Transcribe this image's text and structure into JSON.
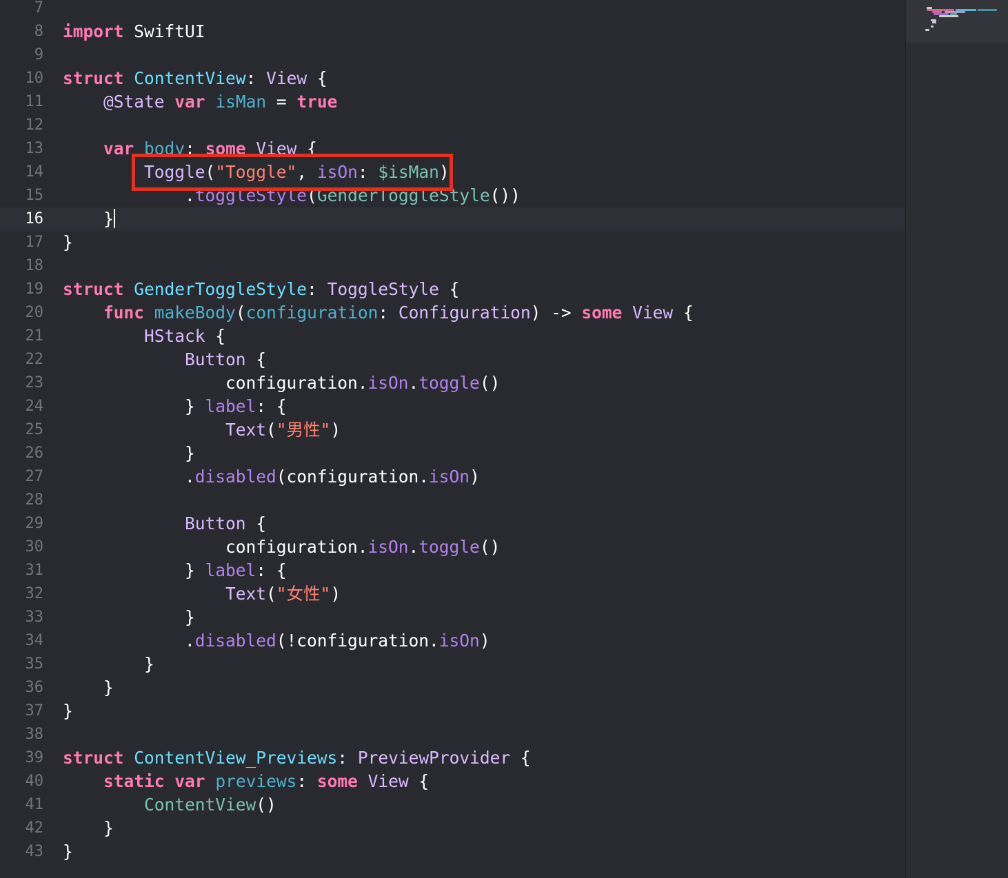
{
  "editor": {
    "language": "Swift",
    "current_line": "16",
    "lines": [
      {
        "n": "7",
        "tokens": []
      },
      {
        "n": "8",
        "tokens": [
          {
            "t": "import",
            "c": "kw"
          },
          {
            "t": " SwiftUI",
            "c": "pl"
          }
        ]
      },
      {
        "n": "9",
        "tokens": []
      },
      {
        "n": "10",
        "tokens": [
          {
            "t": "struct",
            "c": "kw"
          },
          {
            "t": " ",
            "c": "pl"
          },
          {
            "t": "ContentView",
            "c": "decl"
          },
          {
            "t": ": ",
            "c": "pl"
          },
          {
            "t": "View",
            "c": "typ"
          },
          {
            "t": " {",
            "c": "pl"
          }
        ]
      },
      {
        "n": "11",
        "tokens": [
          {
            "t": "    ",
            "c": "pl"
          },
          {
            "t": "@State",
            "c": "typ"
          },
          {
            "t": " ",
            "c": "pl"
          },
          {
            "t": "var",
            "c": "kw"
          },
          {
            "t": " ",
            "c": "pl"
          },
          {
            "t": "isMan",
            "c": "vdecl"
          },
          {
            "t": " = ",
            "c": "pl"
          },
          {
            "t": "true",
            "c": "kw"
          }
        ]
      },
      {
        "n": "12",
        "tokens": []
      },
      {
        "n": "13",
        "tokens": [
          {
            "t": "    ",
            "c": "pl"
          },
          {
            "t": "var",
            "c": "kw"
          },
          {
            "t": " ",
            "c": "pl"
          },
          {
            "t": "body",
            "c": "vdecl"
          },
          {
            "t": ": ",
            "c": "pl"
          },
          {
            "t": "some",
            "c": "kw"
          },
          {
            "t": " ",
            "c": "pl"
          },
          {
            "t": "View",
            "c": "typ"
          },
          {
            "t": " {",
            "c": "pl"
          }
        ]
      },
      {
        "n": "14",
        "tokens": []
      },
      {
        "n": "15",
        "tokens": [
          {
            "t": "            ",
            "c": "pl"
          },
          {
            "t": ".",
            "c": "pl"
          },
          {
            "t": "toggleStyle",
            "c": "mem"
          },
          {
            "t": "(",
            "c": "pl"
          },
          {
            "t": "GenderToggleStyle",
            "c": "prop"
          },
          {
            "t": "())",
            "c": "pl"
          }
        ]
      },
      {
        "n": "16",
        "tokens": [
          {
            "t": "    }",
            "c": "pl"
          }
        ],
        "cursor": true
      },
      {
        "n": "17",
        "tokens": [
          {
            "t": "}",
            "c": "pl"
          }
        ]
      },
      {
        "n": "18",
        "tokens": []
      },
      {
        "n": "19",
        "tokens": [
          {
            "t": "struct",
            "c": "kw"
          },
          {
            "t": " ",
            "c": "pl"
          },
          {
            "t": "GenderToggleStyle",
            "c": "decl"
          },
          {
            "t": ": ",
            "c": "pl"
          },
          {
            "t": "ToggleStyle",
            "c": "typ"
          },
          {
            "t": " {",
            "c": "pl"
          }
        ]
      },
      {
        "n": "20",
        "tokens": [
          {
            "t": "    ",
            "c": "pl"
          },
          {
            "t": "func",
            "c": "kw"
          },
          {
            "t": " ",
            "c": "pl"
          },
          {
            "t": "makeBody",
            "c": "vdecl"
          },
          {
            "t": "(",
            "c": "pl"
          },
          {
            "t": "configuration",
            "c": "vdecl"
          },
          {
            "t": ": ",
            "c": "pl"
          },
          {
            "t": "Configuration",
            "c": "typ"
          },
          {
            "t": ") -> ",
            "c": "pl"
          },
          {
            "t": "some",
            "c": "kw"
          },
          {
            "t": " ",
            "c": "pl"
          },
          {
            "t": "View",
            "c": "typ"
          },
          {
            "t": " {",
            "c": "pl"
          }
        ]
      },
      {
        "n": "21",
        "tokens": [
          {
            "t": "        ",
            "c": "pl"
          },
          {
            "t": "HStack",
            "c": "typ"
          },
          {
            "t": " {",
            "c": "pl"
          }
        ]
      },
      {
        "n": "22",
        "tokens": [
          {
            "t": "            ",
            "c": "pl"
          },
          {
            "t": "Button",
            "c": "typ"
          },
          {
            "t": " {",
            "c": "pl"
          }
        ]
      },
      {
        "n": "23",
        "tokens": [
          {
            "t": "                configuration.",
            "c": "pl"
          },
          {
            "t": "isOn",
            "c": "mem"
          },
          {
            "t": ".",
            "c": "pl"
          },
          {
            "t": "toggle",
            "c": "mem"
          },
          {
            "t": "()",
            "c": "pl"
          }
        ]
      },
      {
        "n": "24",
        "tokens": [
          {
            "t": "            } ",
            "c": "pl"
          },
          {
            "t": "label",
            "c": "mem"
          },
          {
            "t": ": {",
            "c": "pl"
          }
        ]
      },
      {
        "n": "25",
        "tokens": [
          {
            "t": "                ",
            "c": "pl"
          },
          {
            "t": "Text",
            "c": "typ"
          },
          {
            "t": "(",
            "c": "pl"
          },
          {
            "t": "\"男性\"",
            "c": "str"
          },
          {
            "t": ")",
            "c": "pl"
          }
        ]
      },
      {
        "n": "26",
        "tokens": [
          {
            "t": "            }",
            "c": "pl"
          }
        ]
      },
      {
        "n": "27",
        "tokens": [
          {
            "t": "            .",
            "c": "pl"
          },
          {
            "t": "disabled",
            "c": "mem"
          },
          {
            "t": "(configuration.",
            "c": "pl"
          },
          {
            "t": "isOn",
            "c": "mem"
          },
          {
            "t": ")",
            "c": "pl"
          }
        ]
      },
      {
        "n": "28",
        "tokens": []
      },
      {
        "n": "29",
        "tokens": [
          {
            "t": "            ",
            "c": "pl"
          },
          {
            "t": "Button",
            "c": "typ"
          },
          {
            "t": " {",
            "c": "pl"
          }
        ]
      },
      {
        "n": "30",
        "tokens": [
          {
            "t": "                configuration.",
            "c": "pl"
          },
          {
            "t": "isOn",
            "c": "mem"
          },
          {
            "t": ".",
            "c": "pl"
          },
          {
            "t": "toggle",
            "c": "mem"
          },
          {
            "t": "()",
            "c": "pl"
          }
        ]
      },
      {
        "n": "31",
        "tokens": [
          {
            "t": "            } ",
            "c": "pl"
          },
          {
            "t": "label",
            "c": "mem"
          },
          {
            "t": ": {",
            "c": "pl"
          }
        ]
      },
      {
        "n": "32",
        "tokens": [
          {
            "t": "                ",
            "c": "pl"
          },
          {
            "t": "Text",
            "c": "typ"
          },
          {
            "t": "(",
            "c": "pl"
          },
          {
            "t": "\"女性\"",
            "c": "str"
          },
          {
            "t": ")",
            "c": "pl"
          }
        ]
      },
      {
        "n": "33",
        "tokens": [
          {
            "t": "            }",
            "c": "pl"
          }
        ]
      },
      {
        "n": "34",
        "tokens": [
          {
            "t": "            .",
            "c": "pl"
          },
          {
            "t": "disabled",
            "c": "mem"
          },
          {
            "t": "(!configuration.",
            "c": "pl"
          },
          {
            "t": "isOn",
            "c": "mem"
          },
          {
            "t": ")",
            "c": "pl"
          }
        ]
      },
      {
        "n": "35",
        "tokens": [
          {
            "t": "        }",
            "c": "pl"
          }
        ]
      },
      {
        "n": "36",
        "tokens": [
          {
            "t": "    }",
            "c": "pl"
          }
        ]
      },
      {
        "n": "37",
        "tokens": [
          {
            "t": "}",
            "c": "pl"
          }
        ]
      },
      {
        "n": "38",
        "tokens": []
      },
      {
        "n": "39",
        "tokens": [
          {
            "t": "struct",
            "c": "kw"
          },
          {
            "t": " ",
            "c": "pl"
          },
          {
            "t": "ContentView_Previews",
            "c": "decl"
          },
          {
            "t": ": ",
            "c": "pl"
          },
          {
            "t": "PreviewProvider",
            "c": "typ"
          },
          {
            "t": " {",
            "c": "pl"
          }
        ]
      },
      {
        "n": "40",
        "tokens": [
          {
            "t": "    ",
            "c": "pl"
          },
          {
            "t": "static",
            "c": "kw"
          },
          {
            "t": " ",
            "c": "pl"
          },
          {
            "t": "var",
            "c": "kw"
          },
          {
            "t": " ",
            "c": "pl"
          },
          {
            "t": "previews",
            "c": "vdecl"
          },
          {
            "t": ": ",
            "c": "pl"
          },
          {
            "t": "some",
            "c": "kw"
          },
          {
            "t": " ",
            "c": "pl"
          },
          {
            "t": "View",
            "c": "typ"
          },
          {
            "t": " {",
            "c": "pl"
          }
        ]
      },
      {
        "n": "41",
        "tokens": [
          {
            "t": "        ",
            "c": "pl"
          },
          {
            "t": "ContentView",
            "c": "prop"
          },
          {
            "t": "()",
            "c": "pl"
          }
        ]
      },
      {
        "n": "42",
        "tokens": [
          {
            "t": "    }",
            "c": "pl"
          }
        ]
      },
      {
        "n": "43",
        "tokens": [
          {
            "t": "}",
            "c": "pl"
          }
        ]
      }
    ],
    "highlight": {
      "line": "14",
      "tokens": [
        {
          "t": "Toggle",
          "c": "typ"
        },
        {
          "t": "(",
          "c": "pl"
        },
        {
          "t": "\"Toggle\"",
          "c": "str"
        },
        {
          "t": ", ",
          "c": "pl"
        },
        {
          "t": "isOn",
          "c": "mem"
        },
        {
          "t": ": ",
          "c": "pl"
        },
        {
          "t": "$isMan",
          "c": "prop"
        },
        {
          "t": ")",
          "c": "pl"
        }
      ]
    }
  },
  "colors": {
    "background": "#292a30",
    "current_line": "#2f3037",
    "keyword": "#ff7ab2",
    "type": "#dabaff",
    "declaration": "#6bdfff",
    "variable": "#4eb0cc",
    "string": "#ff8170",
    "member": "#b281eb",
    "project": "#78c2b3",
    "annotation_box": "#e6301e"
  },
  "minimap": {
    "strip_colors": [
      "#ff7ab2",
      "#6bdfff",
      "#dabaff",
      "#4eb0cc",
      "#b281eb",
      "#78c2b3",
      "#ffffff"
    ]
  }
}
